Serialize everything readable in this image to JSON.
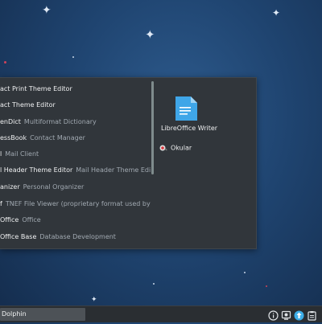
{
  "launcher": {
    "apps": [
      {
        "name": "act Print Theme Editor",
        "desc": ""
      },
      {
        "name": "act Theme Editor",
        "desc": ""
      },
      {
        "name": "enDict",
        "desc": "Multiformat Dictionary"
      },
      {
        "name": "essBook",
        "desc": "Contact Manager"
      },
      {
        "name": "l",
        "desc": "Mail Client"
      },
      {
        "name": "l Header Theme Editor",
        "desc": "Mail Header Theme Edi..."
      },
      {
        "name": "anizer",
        "desc": "Personal Organizer"
      },
      {
        "name": "f",
        "desc": "TNEF File Viewer (proprietary format used by ..."
      },
      {
        "name": "Office",
        "desc": "Office"
      },
      {
        "name": "Office Base",
        "desc": "Database Development"
      }
    ],
    "favorites": {
      "writer_label": "LibreOffice Writer",
      "okular_label": "Okular"
    }
  },
  "taskbar": {
    "task_label": "Dolphin"
  },
  "colors": {
    "popup_bg": "#31363b",
    "desktop_bg": "#1f4470",
    "writer_blue": "#3fa6e8"
  },
  "icons": [
    "star",
    "libreoffice-writer-icon",
    "okular-icon",
    "info-icon",
    "network-icon",
    "updates-icon",
    "clipboard-icon"
  ]
}
